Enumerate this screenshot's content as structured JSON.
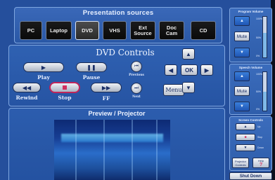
{
  "sources": {
    "title": "Presentation sources",
    "buttons": [
      {
        "label": "PC"
      },
      {
        "label": "Laptop"
      },
      {
        "label": "DVD"
      },
      {
        "label": "VHS"
      },
      {
        "label": "Ext\nSource"
      },
      {
        "label": "Doc\nCam"
      },
      {
        "label": "CD"
      }
    ],
    "active": "DVD"
  },
  "dvd": {
    "title": "DVD Controls",
    "play_label": "Play",
    "pause_label": "Pause",
    "previous_label": "Previous",
    "rewind_label": "Rewind",
    "stop_label": "Stop",
    "ff_label": "FF",
    "next_label": "Next",
    "menu_label": "Menu",
    "ok_label": "OK",
    "play_glyph": "▶",
    "pause_glyph": "❚❚",
    "previous_glyph": "⏮",
    "rewind_glyph": "◀◀",
    "ff_glyph": "▶▶",
    "next_glyph": "⏭",
    "up_glyph": "▲",
    "down_glyph": "▼",
    "left_glyph": "◀",
    "right_glyph": "▶"
  },
  "preview": {
    "title": "Preview / Projector"
  },
  "program_volume": {
    "title": "Program Volume",
    "up_glyph": "▲",
    "down_glyph": "▼",
    "mute_label": "Mute",
    "level": 0.6,
    "pct_top": "100%",
    "pct_mid": "50%",
    "pct_bot": "0%"
  },
  "speech_volume": {
    "title": "Speech Volume",
    "up_glyph": "▲",
    "down_glyph": "▼",
    "mute_label": "Mute",
    "level": 0.5,
    "pct_top": "100%",
    "pct_mid": "50%",
    "pct_bot": "0%"
  },
  "screen_controls": {
    "title": "Screen Controls",
    "up_glyph": "▲",
    "stop_glyph": "■",
    "down_glyph": "▼",
    "up_label": "Up",
    "stop_label": "Stop",
    "down_label": "Down",
    "projector_label_1": "Projector",
    "projector_label_2": "Controls",
    "help_label": "Help",
    "help_glyph": "?"
  },
  "shutdown_label": "Shut Down",
  "colors": {
    "background": "#254f9c",
    "panel_border": "#7fa6e0",
    "stop_accent": "#d23060",
    "volume_button": "#2f6fcc"
  }
}
